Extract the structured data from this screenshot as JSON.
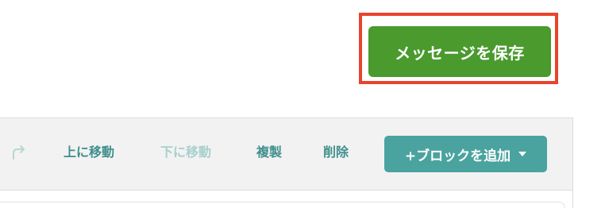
{
  "header": {
    "save_message_label": "メッセージを保存"
  },
  "toolbar": {
    "redo_icon": "redo-icon",
    "move_up_label": "上に移動",
    "move_down_label": "下に移動",
    "move_down_disabled": true,
    "duplicate_label": "複製",
    "delete_label": "削除",
    "add_block_label": "+ブロックを追加"
  },
  "colors": {
    "save_button": "#4a9a2e",
    "highlight": "#e8432c",
    "accent_teal": "#4aa39f",
    "toolbar_text": "#3f8f8c",
    "toolbar_text_disabled": "#a6d0cd"
  }
}
